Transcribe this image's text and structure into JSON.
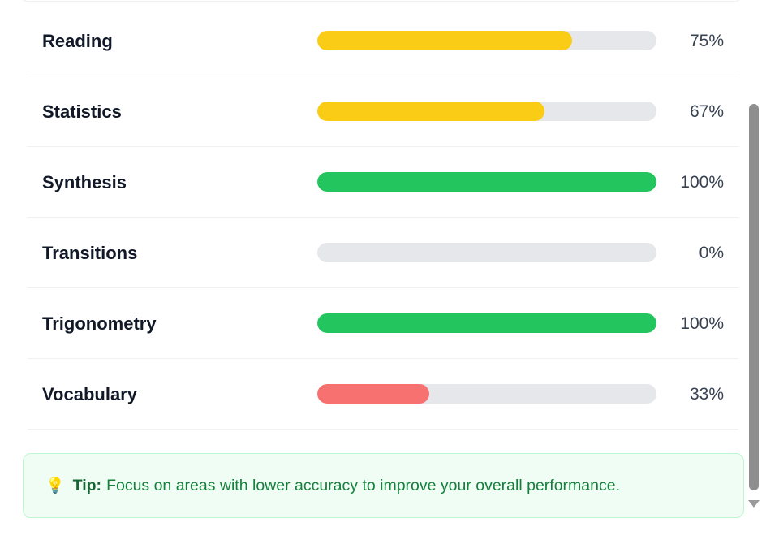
{
  "rows": [
    {
      "topic": "Reading",
      "percent_label": "75%",
      "value": 75,
      "color": "#facc15"
    },
    {
      "topic": "Statistics",
      "percent_label": "67%",
      "value": 67,
      "color": "#facc15"
    },
    {
      "topic": "Synthesis",
      "percent_label": "100%",
      "value": 100,
      "color": "#22c55e"
    },
    {
      "topic": "Transitions",
      "percent_label": "0%",
      "value": 0,
      "color": "#e5e7eb"
    },
    {
      "topic": "Trigonometry",
      "percent_label": "100%",
      "value": 100,
      "color": "#22c55e"
    },
    {
      "topic": "Vocabulary",
      "percent_label": "33%",
      "value": 33,
      "color": "#f87171"
    }
  ],
  "tip": {
    "icon": "lightbulb-icon",
    "glyph": "💡",
    "label": "Tip:",
    "text": "Focus on areas with lower accuracy to improve your overall performance."
  },
  "colors": {
    "track": "#e5e7eb",
    "tip_background": "#f0fdf4",
    "tip_border": "#bbf7d0",
    "tip_text": "#15803d"
  }
}
